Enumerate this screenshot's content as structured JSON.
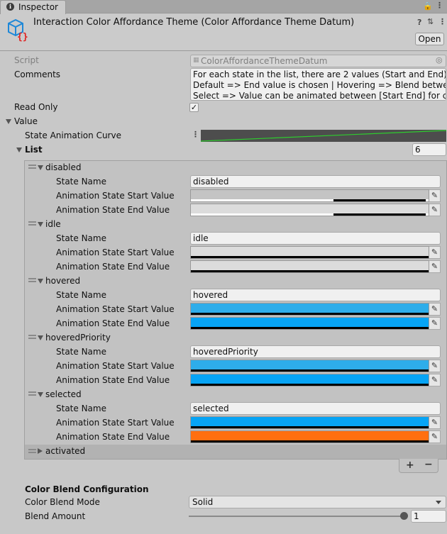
{
  "tab": {
    "label": "Inspector"
  },
  "header": {
    "title": "Interaction Color Affordance Theme (Color Affordance Theme Datum)",
    "open_label": "Open"
  },
  "script": {
    "label": "Script",
    "value": "ColorAffordanceThemeDatum"
  },
  "comments": {
    "label": "Comments",
    "lines": [
      "For each state in the list, there are 2 values (Start and End).",
      "Default => End value is chosen | Hovering => Blend between [S",
      "Select => Value can be animated between [Start End] for click a"
    ]
  },
  "read_only": {
    "label": "Read Only",
    "checked": true
  },
  "value": {
    "label": "Value"
  },
  "curve": {
    "label": "State Animation Curve"
  },
  "list": {
    "label": "List",
    "count": "6",
    "items": [
      {
        "name": "disabled",
        "state_name_label": "State Name",
        "state_name": "disabled",
        "start_label": "Animation State Start Value",
        "end_label": "Animation State End Value",
        "start_color": "#c4c4c4",
        "end_color": "#dcdcdc",
        "start_alpha": 0.6,
        "end_alpha": 0.6
      },
      {
        "name": "idle",
        "state_name_label": "State Name",
        "state_name": "idle",
        "start_label": "Animation State Start Value",
        "end_label": "Animation State End Value",
        "start_color": "#dcdcdc",
        "end_color": "#dcdcdc",
        "start_alpha": 1,
        "end_alpha": 1
      },
      {
        "name": "hovered",
        "state_name_label": "State Name",
        "state_name": "hovered",
        "start_label": "Animation State Start Value",
        "end_label": "Animation State End Value",
        "start_color": "#2eadea",
        "end_color": "#07a4f5",
        "start_alpha": 1,
        "end_alpha": 1
      },
      {
        "name": "hoveredPriority",
        "state_name_label": "State Name",
        "state_name": "hoveredPriority",
        "start_label": "Animation State Start Value",
        "end_label": "Animation State End Value",
        "start_color": "#2eadea",
        "end_color": "#07a4f5",
        "start_alpha": 1,
        "end_alpha": 1
      },
      {
        "name": "selected",
        "state_name_label": "State Name",
        "state_name": "selected",
        "start_label": "Animation State Start Value",
        "end_label": "Animation State End Value",
        "start_color": "#07a4f5",
        "end_color": "#ff6f0f",
        "start_alpha": 1,
        "end_alpha": 1
      },
      {
        "name": "activated"
      }
    ]
  },
  "blend": {
    "section_label": "Color Blend Configuration",
    "mode_label": "Color Blend Mode",
    "mode_value": "Solid",
    "amount_label": "Blend Amount",
    "amount_value": "1",
    "amount_fraction": 1
  },
  "colors": {
    "accent_green": "#2ecc2e",
    "window_bg": "#c8c8c8"
  }
}
